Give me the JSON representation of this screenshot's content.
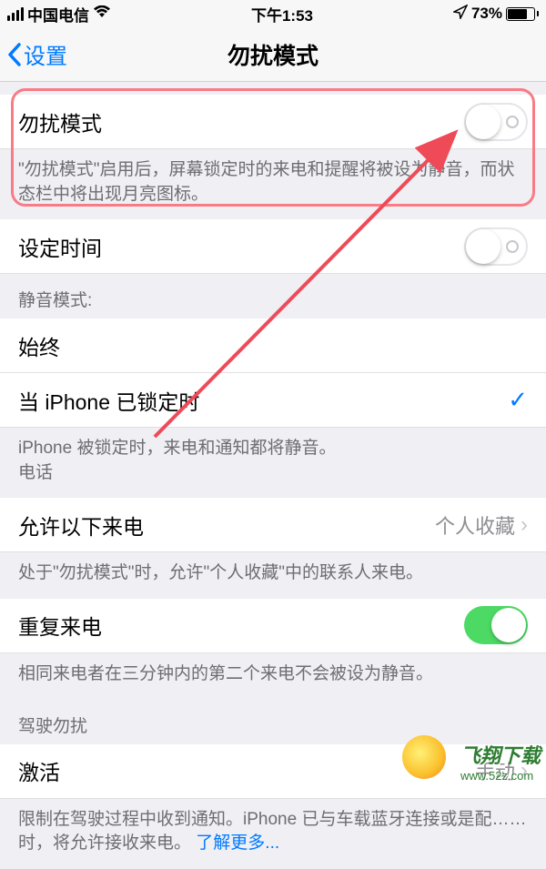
{
  "status": {
    "carrier": "中国电信",
    "time": "下午1:53",
    "battery_pct": "73%"
  },
  "nav": {
    "back_label": "设置",
    "title": "勿扰模式"
  },
  "rows": {
    "dnd_label": "勿扰模式",
    "dnd_on": false,
    "dnd_footer": "\"勿扰模式\"启用后，屏幕锁定时的来电和提醒将被设为静音，而状态栏中将出现月亮图标。",
    "schedule_label": "设定时间",
    "schedule_on": false,
    "silence_header": "静音模式:",
    "always_label": "始终",
    "locked_label": "当 iPhone 已锁定时",
    "locked_selected": true,
    "silence_footer_line1": "iPhone 被锁定时，来电和通知都将静音。",
    "silence_footer_line2": "电话",
    "allow_calls_label": "允许以下来电",
    "allow_calls_value": "个人收藏",
    "allow_calls_footer": "处于\"勿扰模式\"时，允许\"个人收藏\"中的联系人来电。",
    "repeat_label": "重复来电",
    "repeat_on": true,
    "repeat_footer": "相同来电者在三分钟内的第二个来电不会被设为静音。",
    "driving_header": "驾驶勿扰",
    "activate_label": "激活",
    "activate_value": "手动",
    "driving_footer_text": "限制在驾驶过程中收到通知。iPhone 已与车载蓝牙连接或是配……时，将允许接收来电。",
    "learn_more": "了解更多..."
  },
  "watermark": {
    "title": "飞翔下载",
    "url": "www.52z.com"
  }
}
